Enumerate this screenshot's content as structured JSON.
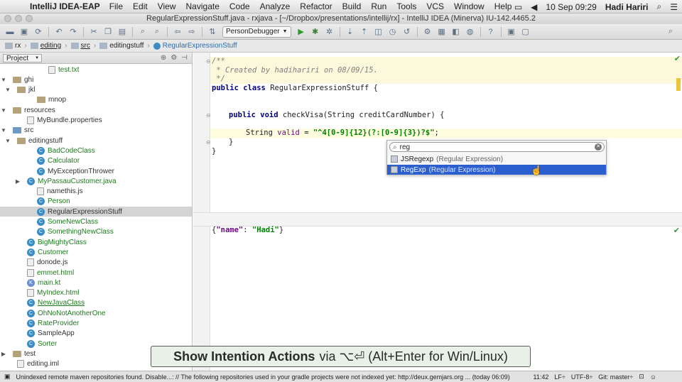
{
  "menubar": {
    "app_name": "IntelliJ IDEA-EAP",
    "items": [
      "File",
      "Edit",
      "View",
      "Navigate",
      "Code",
      "Analyze",
      "Refactor",
      "Build",
      "Run",
      "Tools",
      "VCS",
      "Window",
      "Help"
    ],
    "clock": "10 Sep  09:29",
    "user": "Hadi Hariri"
  },
  "title": "RegularExpressionStuff.java - rxjava - [~/Dropbox/presentations/intellij/rx] - IntelliJ IDEA (Minerva) IU-142.4465.2",
  "toolbar": {
    "run_config": "PersonDebugger"
  },
  "breadcrumbs": [
    "rx",
    "editing",
    "src",
    "editingstuff",
    "RegularExpressionStuff"
  ],
  "project": {
    "header": "Project",
    "rows": [
      {
        "label": "test.txt",
        "indent": 78,
        "kind": "file",
        "color": "green"
      },
      {
        "label": "ghi",
        "indent": 20,
        "kind": "folder",
        "toggle": "▼"
      },
      {
        "label": "jkl",
        "indent": 34,
        "kind": "folder",
        "toggle": "▼"
      },
      {
        "label": "mnop",
        "indent": 62,
        "kind": "folder"
      },
      {
        "label": "resources",
        "indent": 20,
        "kind": "folder",
        "toggle": "▼"
      },
      {
        "label": "MyBundle.properties",
        "indent": 48,
        "kind": "file"
      },
      {
        "label": "src",
        "indent": 20,
        "kind": "src",
        "toggle": "▼"
      },
      {
        "label": "editingstuff",
        "indent": 34,
        "kind": "folder",
        "toggle": "▼"
      },
      {
        "label": "BadCodeClass",
        "indent": 62,
        "kind": "class",
        "color": "green"
      },
      {
        "label": "Calculator",
        "indent": 62,
        "kind": "class",
        "color": "green"
      },
      {
        "label": "MyExceptionThrower",
        "indent": 62,
        "kind": "class"
      },
      {
        "label": "MyPassauCustomer.java",
        "indent": 48,
        "kind": "class",
        "color": "green",
        "toggle": "▶"
      },
      {
        "label": "namethis.js",
        "indent": 62,
        "kind": "file"
      },
      {
        "label": "Person",
        "indent": 62,
        "kind": "class",
        "color": "green"
      },
      {
        "label": "RegularExpressionStuff",
        "indent": 62,
        "kind": "class",
        "selected": true
      },
      {
        "label": "SomeNewClass",
        "indent": 62,
        "kind": "class",
        "color": "green"
      },
      {
        "label": "SomethingNewClass",
        "indent": 62,
        "kind": "class",
        "color": "green"
      },
      {
        "label": "BigMightyClass",
        "indent": 48,
        "kind": "class",
        "color": "green"
      },
      {
        "label": "Customer",
        "indent": 48,
        "kind": "class",
        "color": "green"
      },
      {
        "label": "donode.js",
        "indent": 48,
        "kind": "file"
      },
      {
        "label": "emmet.html",
        "indent": 48,
        "kind": "file",
        "color": "green"
      },
      {
        "label": "main.kt",
        "indent": 48,
        "kind": "kotlin",
        "color": "green"
      },
      {
        "label": "MyIndex.html",
        "indent": 48,
        "kind": "file",
        "color": "green"
      },
      {
        "label": "NewJavaClass",
        "indent": 48,
        "kind": "class",
        "color": "green"
      },
      {
        "label": "OhNoNotAnotherOne",
        "indent": 48,
        "kind": "class",
        "color": "green"
      },
      {
        "label": "RateProvider",
        "indent": 48,
        "kind": "class",
        "color": "green"
      },
      {
        "label": "SampleApp",
        "indent": 48,
        "kind": "class"
      },
      {
        "label": "Sorter",
        "indent": 48,
        "kind": "class",
        "color": "green"
      },
      {
        "label": "test",
        "indent": 20,
        "kind": "folder",
        "toggle": "▶"
      },
      {
        "label": "editing.iml",
        "indent": 34,
        "kind": "file"
      }
    ]
  },
  "editor": {
    "comment1": "/**",
    "comment2": " * Created by hadihariri on 08/09/15.",
    "comment3": " */",
    "kw_public": "public",
    "kw_class": "class",
    "class_name": "RegularExpressionStuff {",
    "kw_void": "void",
    "method_sig": "checkVisa(String creditCardNumber) {",
    "string_type": "String",
    "var_name": "valid",
    "assign": " = ",
    "regex": "\"^4[0-9]{12}(?:[0-9]{3})?$\"",
    "semicolon": ";",
    "brace_close": "}",
    "json_open": "{",
    "json_key": "\"name\"",
    "json_colon": ": ",
    "json_value": "\"Hadi\"",
    "json_close": "}"
  },
  "popup": {
    "search_value": "reg",
    "items": [
      {
        "name": "JSRegexp",
        "hint": "(Regular Expression)",
        "selected": false
      },
      {
        "name": "RegExp",
        "hint": "(Regular Expression)",
        "selected": true
      }
    ]
  },
  "overlay": {
    "strong": "Show Intention Actions",
    "rest": "via ⌥⏎ (Alt+Enter for Win/Linux)"
  },
  "status": {
    "message": "Unindexed remote maven repositories found. Disable...: // The following repositories used in your gradle projects were not indexed yet: http://deux.gemjars.org ... (today 06:09)",
    "position": "11:42",
    "line_sep": "LF÷",
    "encoding": "UTF-8÷",
    "git": "Git: master÷"
  }
}
